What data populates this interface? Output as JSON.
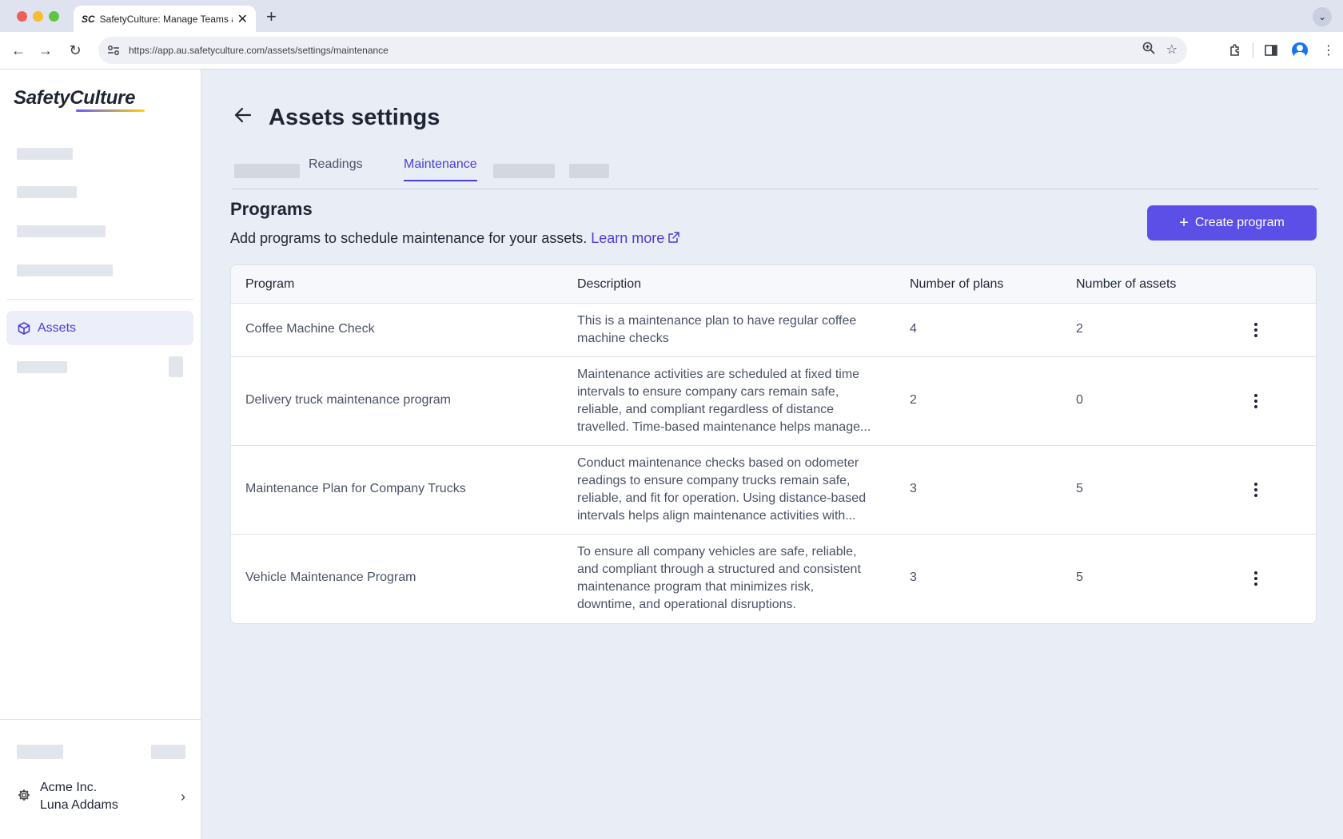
{
  "browser": {
    "tab_favicon": "SC",
    "tab_title": "SafetyCulture: Manage Teams and...",
    "url": "https://app.au.safetyculture.com/assets/settings/maintenance"
  },
  "sidebar": {
    "logo_text": "SafetyCulture",
    "active_item": "Assets",
    "org_name": "Acme Inc.",
    "user_name": "Luna Addams"
  },
  "page": {
    "title": "Assets settings",
    "tabs": [
      "Readings",
      "Maintenance"
    ],
    "active_tab": "Maintenance"
  },
  "programs": {
    "title": "Programs",
    "description": "Add programs to schedule maintenance for your assets.",
    "learn_more": "Learn more",
    "create_button": "Create program",
    "columns": [
      "Program",
      "Description",
      "Number of plans",
      "Number of assets"
    ],
    "rows": [
      {
        "program": "Coffee Machine Check",
        "description_lines": [
          "This is a maintenance plan to have regular coffee",
          "machine checks"
        ],
        "plans": "4",
        "assets": "2"
      },
      {
        "program": "Delivery truck maintenance program",
        "description_lines": [
          "Maintenance activities are scheduled at fixed time",
          "intervals to ensure company cars remain safe,",
          "reliable, and compliant regardless of distance",
          "travelled. Time-based maintenance helps manage..."
        ],
        "plans": "2",
        "assets": "0"
      },
      {
        "program": "Maintenance Plan for Company Trucks",
        "description_lines": [
          "Conduct maintenance checks based on odometer",
          "readings to ensure company trucks remain safe,",
          "reliable, and fit for operation. Using distance-based",
          "intervals helps align maintenance activities with..."
        ],
        "plans": "3",
        "assets": "5"
      },
      {
        "program": "Vehicle Maintenance Program",
        "description_lines": [
          "To ensure all company vehicles are safe, reliable,",
          "and compliant through a structured and consistent",
          "maintenance program that minimizes risk,",
          "downtime, and operational disruptions."
        ],
        "plans": "3",
        "assets": "5"
      }
    ]
  },
  "colors": {
    "accent": "#5b4fe8",
    "link": "#4a3fd6",
    "background": "#e9edf6"
  }
}
